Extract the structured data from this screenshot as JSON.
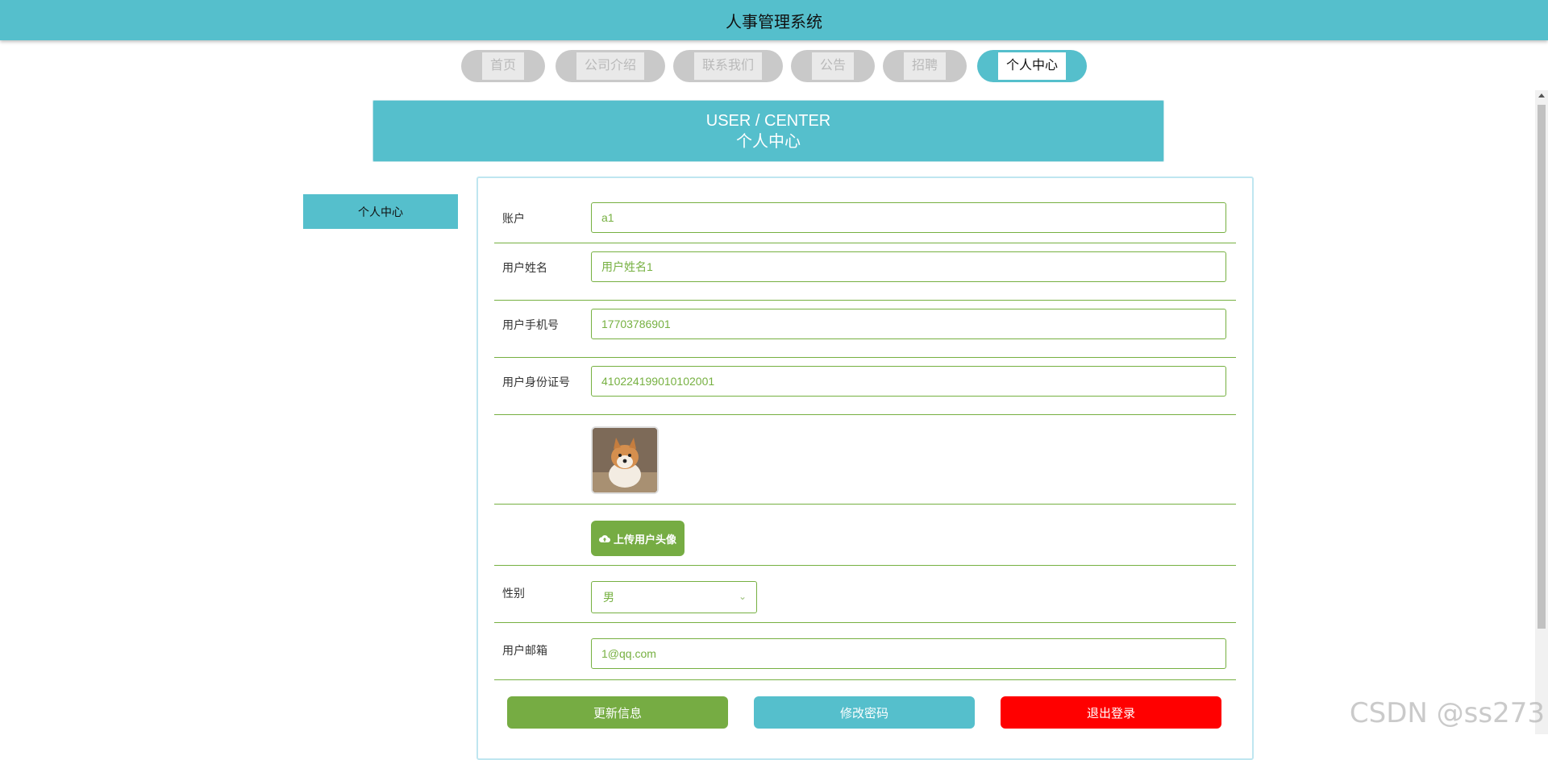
{
  "header": {
    "title": "人事管理系统"
  },
  "nav": {
    "items": [
      {
        "label": "首页"
      },
      {
        "label": "公司介绍"
      },
      {
        "label": "联系我们"
      },
      {
        "label": "公告"
      },
      {
        "label": "招聘"
      },
      {
        "label": "个人中心"
      }
    ]
  },
  "banner": {
    "en": "USER / CENTER",
    "cn": "个人中心"
  },
  "sidebar": {
    "items": [
      {
        "label": "个人中心"
      }
    ]
  },
  "form": {
    "account_label": "账户",
    "account_value": "a1",
    "name_label": "用户姓名",
    "name_value": "用户姓名1",
    "phone_label": "用户手机号",
    "phone_value": "17703786901",
    "idcard_label": "用户身份证号",
    "idcard_value": "410224199010102001",
    "upload_label": "上传用户头像",
    "gender_label": "性别",
    "gender_value": "男",
    "email_label": "用户邮箱",
    "email_value": "1@qq.com"
  },
  "actions": {
    "update_label": "更新信息",
    "password_label": "修改密码",
    "logout_label": "退出登录"
  },
  "colors": {
    "primary": "#55bfcc",
    "green": "#76ac43",
    "red": "#ff0000"
  },
  "watermark": "CSDN @ss273"
}
